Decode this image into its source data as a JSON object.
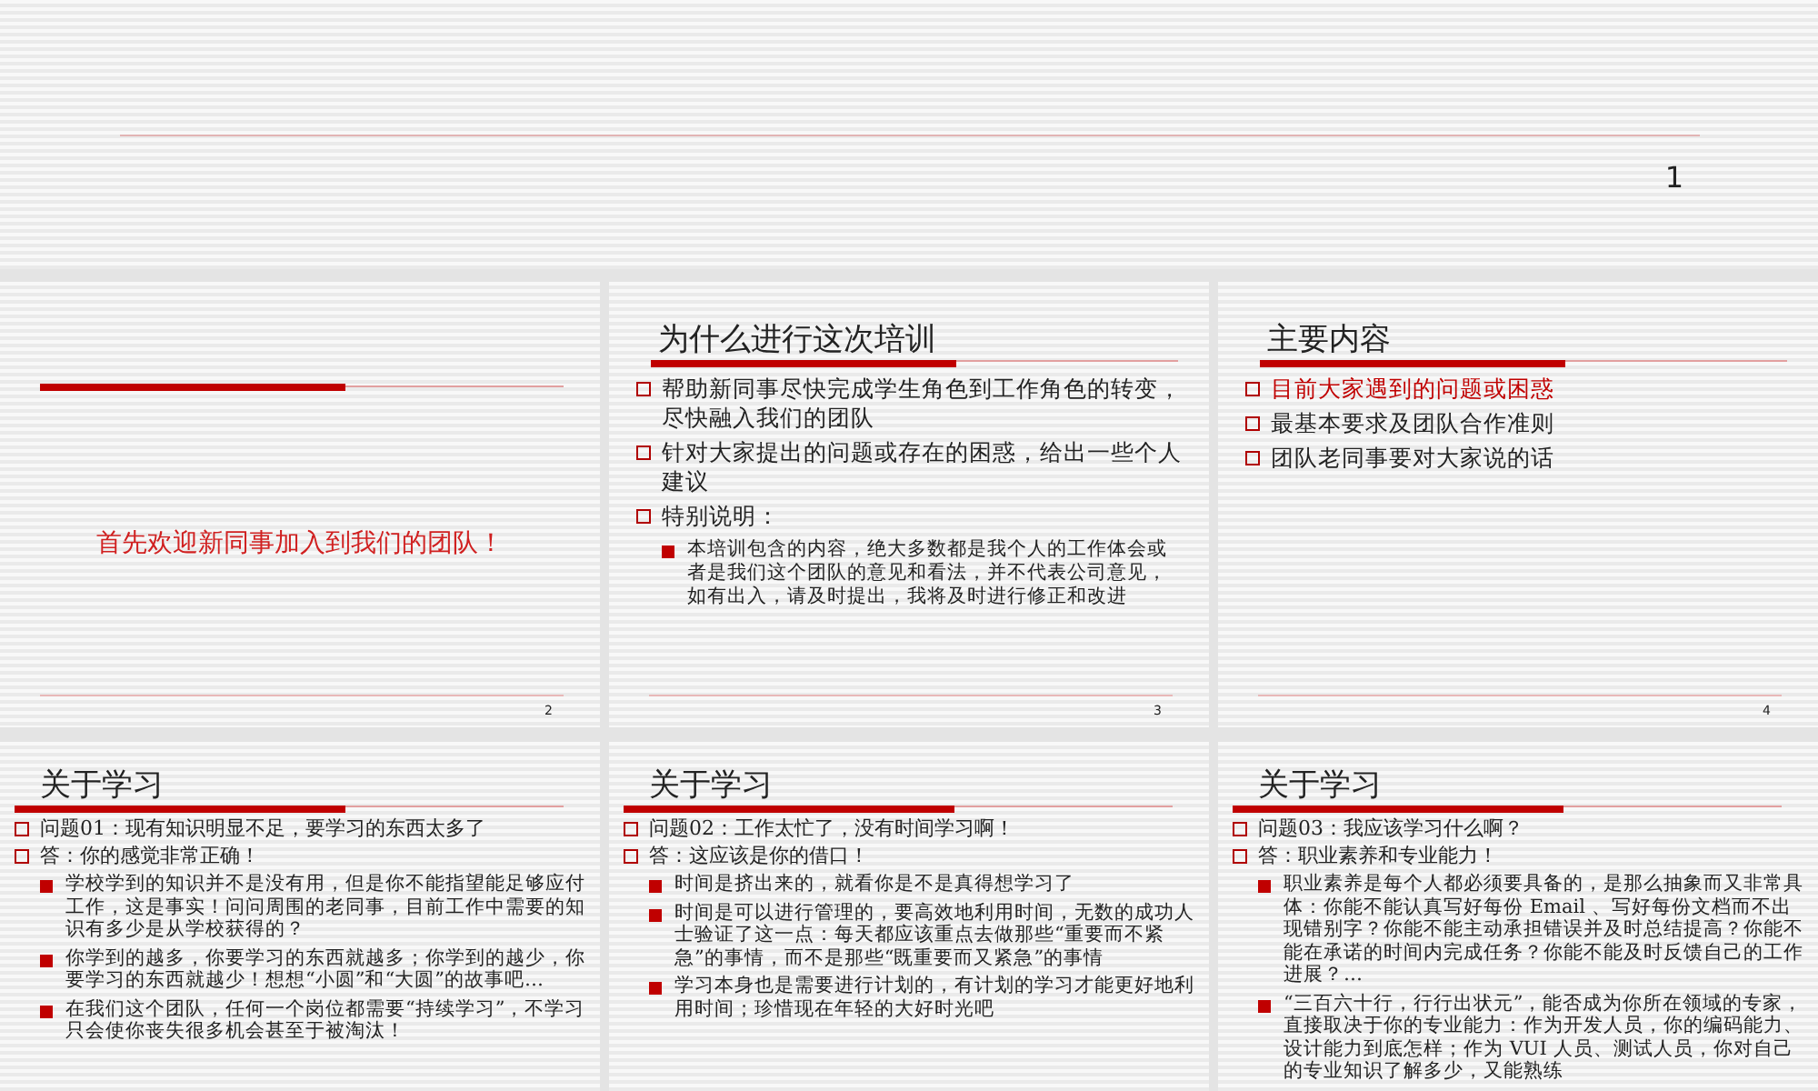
{
  "top_slide": {
    "page_number": "1"
  },
  "slides": [
    {
      "kind": "title",
      "text": "首先欢迎新同事加入到我们的团队！",
      "page_number": "2"
    },
    {
      "kind": "content",
      "title": "为什么进行这次培训",
      "page_number": "3",
      "bullets": [
        {
          "text": "帮助新同事尽快完成学生角色到工作角色的转变，尽快融入我们的团队",
          "highlighted": false
        },
        {
          "text": "针对大家提出的问题或存在的困惑，给出一些个人建议",
          "highlighted": false
        },
        {
          "text": "特别说明：",
          "highlighted": false,
          "children": [
            {
              "text": "本培训包含的内容，绝大多数都是我个人的工作体会或者是我们这个团队的意见和看法，并不代表公司意见，如有出入，请及时提出，我将及时进行修正和改进"
            }
          ]
        }
      ]
    },
    {
      "kind": "content",
      "title": "主要内容",
      "page_number": "4",
      "bullets": [
        {
          "text": "目前大家遇到的问题或困惑",
          "highlighted": true
        },
        {
          "text": "最基本要求及团队合作准则",
          "highlighted": false
        },
        {
          "text": "团队老同事要对大家说的话",
          "highlighted": false
        }
      ]
    },
    {
      "kind": "content",
      "title": "关于学习",
      "bullets": [
        {
          "text": "问题01：现有知识明显不足，要学习的东西太多了",
          "highlighted": false
        },
        {
          "text": "答：你的感觉非常正确！",
          "highlighted": false,
          "children": [
            {
              "text": "学校学到的知识并不是没有用，但是你不能指望能足够应付工作，这是事实！问问周围的老同事，目前工作中需要的知识有多少是从学校获得的？"
            },
            {
              "text": "你学到的越多，你要学习的东西就越多；你学到的越少，你要学习的东西就越少！想想“小圆”和“大圆”的故事吧…"
            },
            {
              "text": "在我们这个团队，任何一个岗位都需要“持续学习”，不学习只会使你丧失很多机会甚至于被淘汰！"
            }
          ]
        }
      ]
    },
    {
      "kind": "content",
      "title": "关于学习",
      "bullets": [
        {
          "text": "问题02：工作太忙了，没有时间学习啊！",
          "highlighted": false
        },
        {
          "text": "答：这应该是你的借口！",
          "highlighted": false,
          "children": [
            {
              "text": "时间是挤出来的，就看你是不是真得想学习了"
            },
            {
              "text": "时间是可以进行管理的，要高效地利用时间，无数的成功人士验证了这一点：每天都应该重点去做那些“重要而不紧急”的事情，而不是那些“既重要而又紧急”的事情"
            },
            {
              "text": "学习本身也是需要进行计划的，有计划的学习才能更好地利用时间；珍惜现在年轻的大好时光吧"
            }
          ]
        }
      ]
    },
    {
      "kind": "content",
      "title": "关于学习",
      "bullets": [
        {
          "text": "问题03：我应该学习什么啊？",
          "highlighted": false
        },
        {
          "text": "答：职业素养和专业能力！",
          "highlighted": false,
          "children": [
            {
              "text": "职业素养是每个人都必须要具备的，是那么抽象而又非常具体：你能不能认真写好每份 Email 、写好每份文档而不出现错别字？你能不能主动承担错误并及时总结提高？你能不能在承诺的时间内完成任务？你能不能及时反馈自己的工作进展？…"
            },
            {
              "text": "“三百六十行，行行出状元”，能否成为你所在领域的专家，直接取决于你的专业能力：作为开发人员，你的编码能力、设计能力到底怎样；作为 VUI 人员、测试人员，你对自己的专业知识了解多少，又能熟练"
            }
          ]
        }
      ]
    }
  ]
}
